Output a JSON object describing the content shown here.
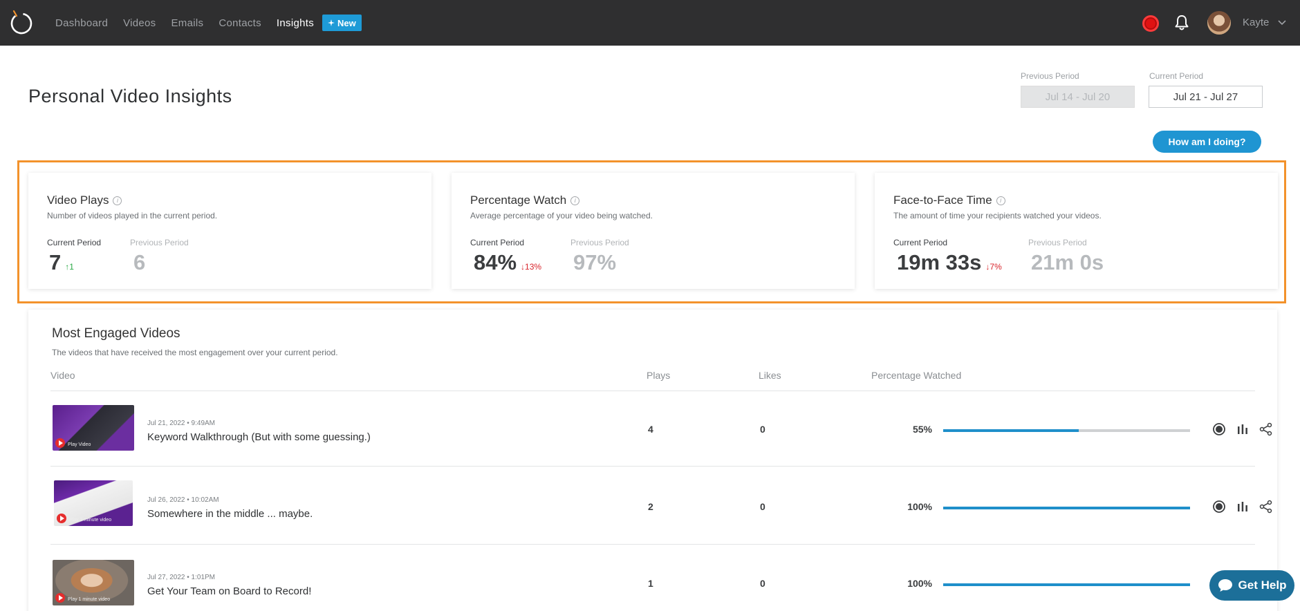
{
  "nav": {
    "items": [
      "Dashboard",
      "Videos",
      "Emails",
      "Contacts"
    ],
    "active": "Insights",
    "new_badge": "New",
    "user_name": "Kayte"
  },
  "header": {
    "title": "Personal Video Insights",
    "previous_period_label": "Previous Period",
    "previous_period_value": "Jul 14 - Jul 20",
    "current_period_label": "Current Period",
    "current_period_value": "Jul 21 - Jul 27",
    "how_button": "How am I doing?"
  },
  "stats": [
    {
      "title": "Video Plays",
      "desc": "Number of videos played in the current period.",
      "cur_label": "Current Period",
      "prev_label": "Previous Period",
      "cur": "7",
      "delta": "↑1",
      "delta_dir": "up",
      "prev": "6"
    },
    {
      "title": "Percentage Watch",
      "desc": "Average percentage of your video being watched.",
      "cur_label": "Current Period",
      "prev_label": "Previous Period",
      "cur": "84%",
      "delta": "↓13%",
      "delta_dir": "down",
      "prev": "97%"
    },
    {
      "title": "Face-to-Face Time",
      "desc": "The amount of time your recipients watched your videos.",
      "cur_label": "Current Period",
      "prev_label": "Previous Period",
      "cur": "19m 33s",
      "delta": "↓7%",
      "delta_dir": "down",
      "prev": "21m 0s"
    }
  ],
  "engaged": {
    "title": "Most Engaged Videos",
    "desc": "The videos that have received the most engagement over your current period.",
    "columns": {
      "video": "Video",
      "plays": "Plays",
      "likes": "Likes",
      "pct": "Percentage Watched"
    },
    "rows": [
      {
        "date": "Jul 21, 2022 • 9:49AM",
        "title": "Keyword Walkthrough (But with some guessing.)",
        "plays": "4",
        "likes": "0",
        "pct_label": "55%",
        "pct": 55,
        "thumb_caption": "Play Video"
      },
      {
        "date": "Jul 26, 2022 • 10:02AM",
        "title": "Somewhere in the middle ... maybe.",
        "plays": "2",
        "likes": "0",
        "pct_label": "100%",
        "pct": 100,
        "thumb_caption": "Play 3 minute video"
      },
      {
        "date": "Jul 27, 2022 • 1:01PM",
        "title": "Get Your Team on Board to Record!",
        "plays": "1",
        "likes": "0",
        "pct_label": "100%",
        "pct": 100,
        "thumb_caption": "Play 1 minute video"
      }
    ]
  },
  "help": {
    "label": "Get Help"
  },
  "colors": {
    "accent": "#1f95d2",
    "highlight": "#f3922b",
    "up": "#27a844",
    "down": "#d8232a"
  }
}
